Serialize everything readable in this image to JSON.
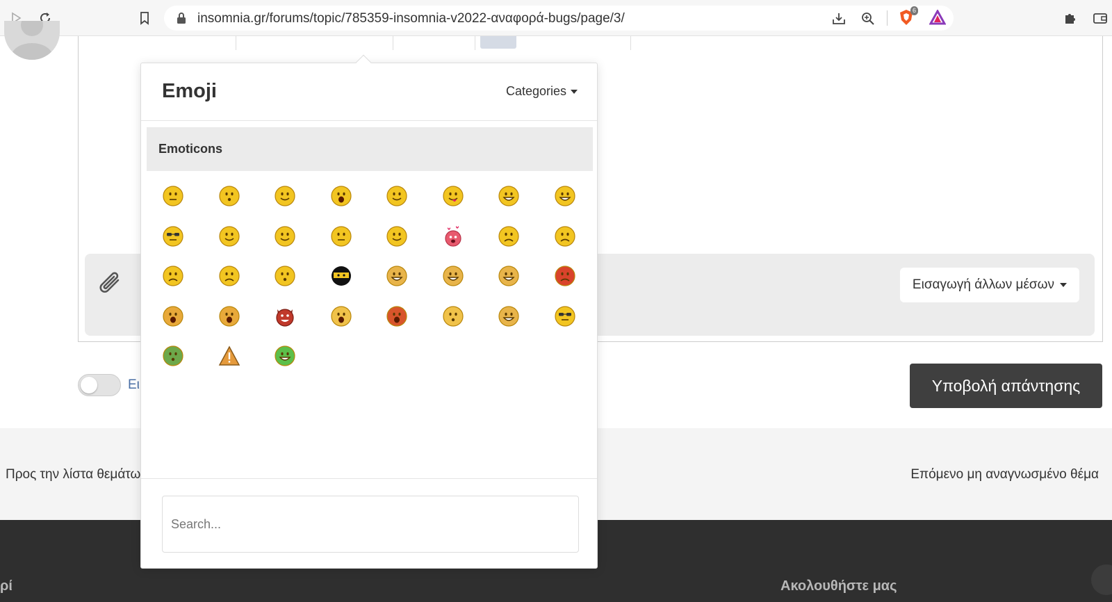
{
  "browser": {
    "url": "insomnia.gr/forums/topic/785359-insomnia-v2022-αναφορά-bugs/page/3/",
    "shields_count": "6"
  },
  "editor": {
    "more_media_label": "Εισαγωγή άλλων μέσων",
    "toggle_label": "Ει",
    "submit_label": "Υποβολή απάντησης"
  },
  "topic_nav": {
    "back_label": "Προς την λίστα θεμάτων",
    "next_label": "Επόμενο μη αναγνωσμένο θέμα"
  },
  "footer": {
    "left_heading": "ρί",
    "right_heading": "Ακολουθήστε μας"
  },
  "emoji_popup": {
    "title": "Emoji",
    "categories_label": "Categories",
    "section_title": "Emoticons",
    "search_placeholder": "Search...",
    "emojis": [
      {
        "name": "neutral-smile",
        "face": "#f2c521",
        "mood": "neutral"
      },
      {
        "name": "surprised",
        "face": "#f2c521",
        "mood": "o"
      },
      {
        "name": "content",
        "face": "#f2c521",
        "mood": "smile"
      },
      {
        "name": "shocked",
        "face": "#f2c521",
        "mood": "bigo"
      },
      {
        "name": "wink",
        "face": "#f2c521",
        "mood": "smile"
      },
      {
        "name": "tongue-out",
        "face": "#f2c521",
        "mood": "tongue"
      },
      {
        "name": "big-grin",
        "face": "#f2c521",
        "mood": "grin"
      },
      {
        "name": "laughing",
        "face": "#f2c521",
        "mood": "grin"
      },
      {
        "name": "cool",
        "face": "#f2c521",
        "mood": "glasses"
      },
      {
        "name": "rolling-eyes",
        "face": "#f2c521",
        "mood": "smile"
      },
      {
        "name": "relieved",
        "face": "#f2c521",
        "mood": "smile"
      },
      {
        "name": "smirk",
        "face": "#f2c521",
        "mood": "neutral"
      },
      {
        "name": "happy",
        "face": "#f2c521",
        "mood": "smile"
      },
      {
        "name": "in-love",
        "face": "#e85a6e",
        "mood": "love"
      },
      {
        "name": "angry",
        "face": "#f2c521",
        "mood": "frown"
      },
      {
        "name": "worried",
        "face": "#f2c521",
        "mood": "frown"
      },
      {
        "name": "sad-teary",
        "face": "#f2c521",
        "mood": "frown"
      },
      {
        "name": "confused",
        "face": "#f2c521",
        "mood": "frown"
      },
      {
        "name": "dizzy",
        "face": "#f2c521",
        "mood": "o"
      },
      {
        "name": "ninja",
        "face": "#111111",
        "mood": "ninja"
      },
      {
        "name": "nervous-grin",
        "face": "#e8b44a",
        "mood": "grin"
      },
      {
        "name": "grimace",
        "face": "#e8b44a",
        "mood": "grin"
      },
      {
        "name": "grinning",
        "face": "#e8b44a",
        "mood": "grin"
      },
      {
        "name": "furious",
        "face": "#d9432b",
        "mood": "frown"
      },
      {
        "name": "screaming",
        "face": "#e8a93a",
        "mood": "bigo"
      },
      {
        "name": "crying",
        "face": "#e8a93a",
        "mood": "bigo"
      },
      {
        "name": "devil",
        "face": "#c0392b",
        "mood": "devil"
      },
      {
        "name": "astonished",
        "face": "#f0c24a",
        "mood": "bigo"
      },
      {
        "name": "yelling",
        "face": "#d8552b",
        "mood": "bigo"
      },
      {
        "name": "thinking",
        "face": "#f0c24a",
        "mood": "o"
      },
      {
        "name": "frustrated",
        "face": "#e8b44a",
        "mood": "grin"
      },
      {
        "name": "nerd",
        "face": "#f2c521",
        "mood": "glasses"
      },
      {
        "name": "sick",
        "face": "#6da84a",
        "mood": "o"
      },
      {
        "name": "warning",
        "face": "#e59a3c",
        "mood": "warning"
      },
      {
        "name": "green-grin",
        "face": "#5cbf4a",
        "mood": "grin"
      }
    ]
  }
}
